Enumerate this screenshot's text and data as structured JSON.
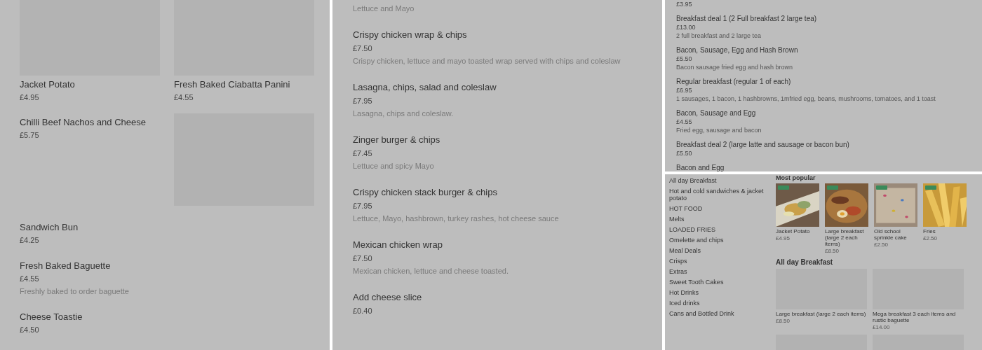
{
  "left_panel": {
    "featured": [
      {
        "name": "Jacket Potato",
        "price": "£4.95"
      },
      {
        "name": "Fresh Baked Ciabatta Panini",
        "price": "£4.55"
      }
    ],
    "items": [
      {
        "name": "Chilli Beef Nachos and Cheese",
        "price": "£5.75",
        "image": true
      },
      {
        "name": "Sandwich Bun",
        "price": "£4.25"
      },
      {
        "name": "Fresh Baked Baguette",
        "price": "£4.55",
        "description": "Freshly baked to order baguette"
      },
      {
        "name": "Cheese Toastie",
        "price": "£4.50"
      }
    ]
  },
  "middle_panel": {
    "top_note": "Lettuce and Mayo",
    "items": [
      {
        "name": "Crispy chicken wrap & chips",
        "price": "£7.50",
        "description": "Crispy chicken, lettuce and mayo toasted wrap served with chips and coleslaw"
      },
      {
        "name": "Lasagna, chips, salad and coleslaw",
        "price": "£7.95",
        "description": "Lasagna, chips and coleslaw."
      },
      {
        "name": "Zinger burger & chips",
        "price": "£7.45",
        "description": "Lettuce and spicy Mayo"
      },
      {
        "name": "Crispy chicken stack burger & chips",
        "price": "£7.95",
        "description": "Lettuce, Mayo, hashbrown, turkey rashes, hot cheese sauce"
      },
      {
        "name": "Mexican chicken wrap",
        "price": "£7.50",
        "description": "Mexican chicken, lettuce and cheese toasted."
      },
      {
        "name": "Add cheese slice",
        "price": "£0.40"
      }
    ]
  },
  "top_right_panel": {
    "top_price": "£3.95",
    "items": [
      {
        "name": "Breakfast deal 1 (2 Full breakfast 2 large tea)",
        "price": "£13.00",
        "description": "2 full breakfast and 2 large tea"
      },
      {
        "name": "Bacon, Sausage, Egg and Hash Brown",
        "price": "£5.50",
        "description": "Bacon sausage fried egg and hash brown"
      },
      {
        "name": "Regular breakfast (regular 1 of each)",
        "price": "£6.95",
        "description": "1 sausages, 1 bacon, 1 hashbrowns, 1mfried egg, beans, mushrooms, tomatoes, and 1 toast"
      },
      {
        "name": "Bacon, Sausage and Egg",
        "price": "£4.55",
        "description": "Fried egg, sausage and bacon"
      },
      {
        "name": "Breakfast deal 2 (large latte and sausage or bacon bun)",
        "price": "£5.50"
      },
      {
        "name": "Bacon and Egg"
      }
    ]
  },
  "bottom_right_panel": {
    "categories": [
      "All day Breakfast",
      "Hot and cold sandwiches & jacket potato",
      "HOT FOOD",
      "Melts",
      "LOADED FRIES",
      "Omelette and chips",
      "Meal Deals",
      "Crisps",
      "Extras",
      "Sweet Tooth Cakes",
      "Hot Drinks",
      "Iced drinks",
      "Cans and Bottled Drink"
    ],
    "popular_heading": "Most popular",
    "popular": [
      {
        "name": "Jacket Potato",
        "price": "£4.95",
        "kind": "potato"
      },
      {
        "name": "Large breakfast (large 2 each items)",
        "price": "£8.50",
        "kind": "breakfast"
      },
      {
        "name": "Old school sprinkle cake",
        "price": "£2.50",
        "kind": "cake"
      },
      {
        "name": "Fries",
        "price": "£2.50",
        "kind": "fries"
      }
    ],
    "section_heading": "All day Breakfast",
    "section_items": [
      {
        "name": "Large breakfast (large 2 each items)",
        "price": "£8.50",
        "image": true
      },
      {
        "name": "Mega breakfast 3 each items and rustic baguette",
        "price": "£14.00",
        "image": true
      },
      {
        "image": true
      },
      {
        "image": true
      }
    ]
  }
}
